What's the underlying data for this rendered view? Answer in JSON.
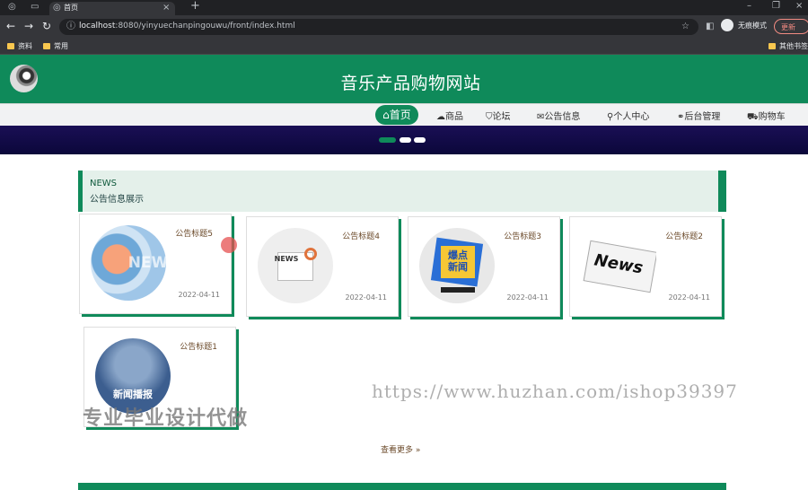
{
  "browser": {
    "tab_title": "首页",
    "new_tab_glyph": "+",
    "url_host": "localhost",
    "url_path": ":8080/yinyuechanpingouwu/front/index.html",
    "incognito_label": "无痕模式",
    "update_label": "更新",
    "bookmarks": [
      "资料",
      "常用"
    ],
    "other_bookmarks": "其他书签"
  },
  "site": {
    "title": "音乐产品购物网站",
    "nav": [
      {
        "label": "首页",
        "icon": "home-icon"
      },
      {
        "label": "商品",
        "icon": "cloud-icon"
      },
      {
        "label": "论坛",
        "icon": "shield-icon"
      },
      {
        "label": "公告信息",
        "icon": "mail-icon"
      },
      {
        "label": "个人中心",
        "icon": "user-icon"
      },
      {
        "label": "后台管理",
        "icon": "link-icon"
      },
      {
        "label": "购物车",
        "icon": "cart-icon"
      }
    ],
    "carousel": {
      "slides": 3,
      "active": 1
    }
  },
  "notices": {
    "section_en": "NEWS",
    "section_zh": "公告信息展示",
    "items": [
      {
        "title": "公告标题5",
        "date": "2022-04-11",
        "thumb_text": "NEW"
      },
      {
        "title": "公告标题4",
        "date": "2022-04-11",
        "thumb_text": "NEWS"
      },
      {
        "title": "公告标题3",
        "date": "2022-04-11",
        "thumb_text": "爆点新闻"
      },
      {
        "title": "公告标题2",
        "date": "2022-04-11",
        "thumb_text": "News"
      },
      {
        "title": "公告标题1",
        "date": "",
        "thumb_text": "新闻播报"
      }
    ],
    "more_label": "查看更多",
    "more_glyph": "»"
  },
  "watermarks": {
    "url": "https://www.huzhan.com/ishop39397",
    "text": "专业毕业设计代做"
  },
  "colors": {
    "brand_green": "#0f8a5a",
    "banner_navy": "#0b073a"
  }
}
